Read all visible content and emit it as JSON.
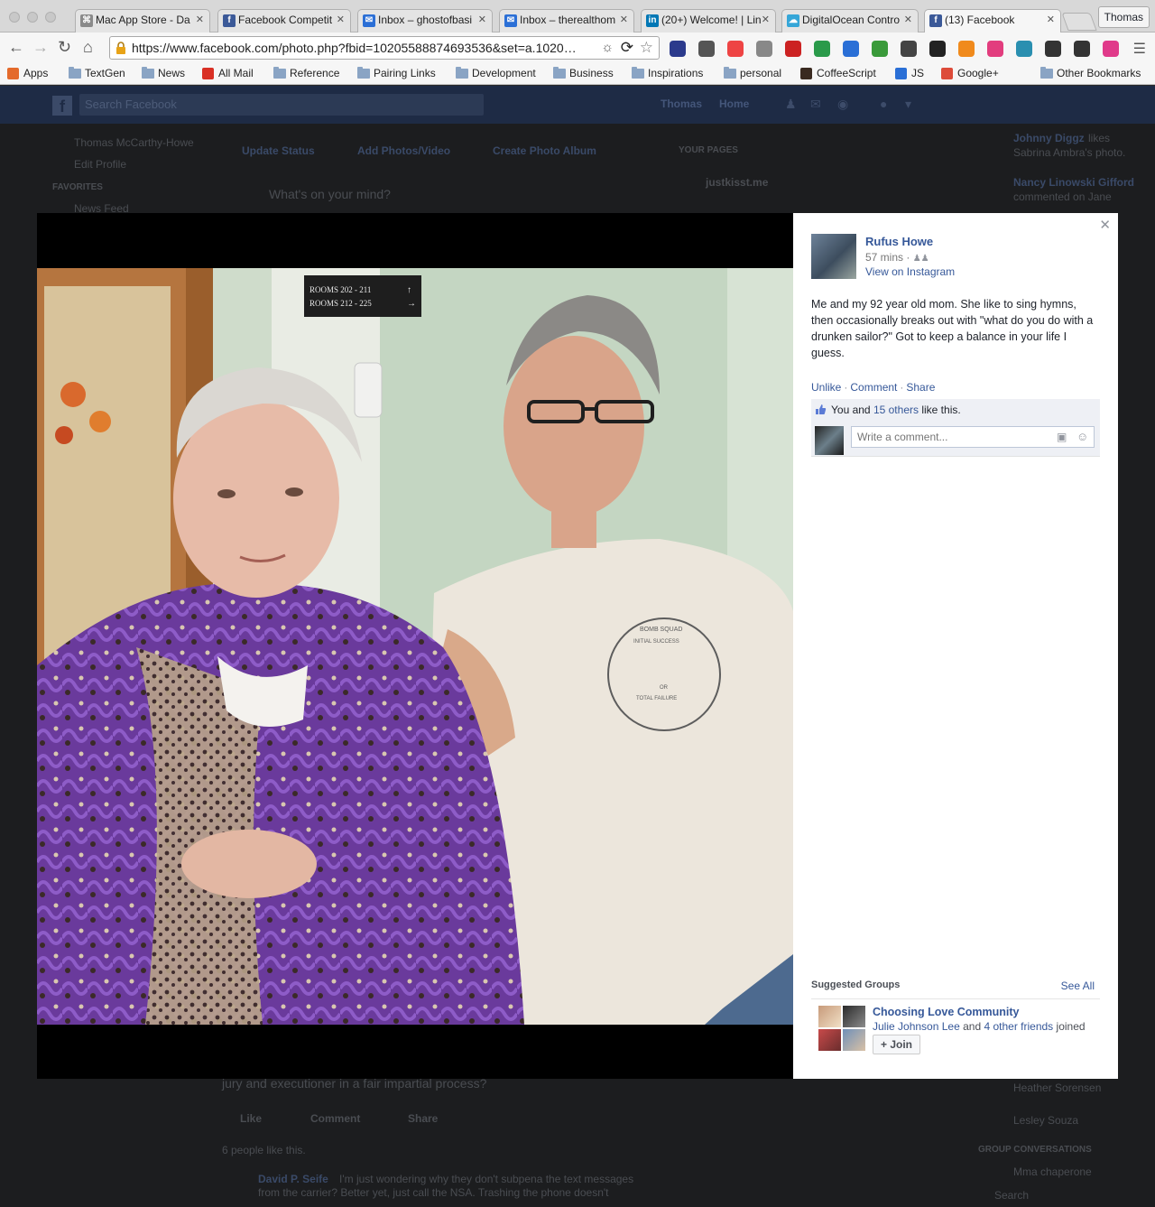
{
  "browser": {
    "tabs": [
      {
        "label": "Mac App Store - Da",
        "color": "#8a8a8a",
        "glyph": "⌘"
      },
      {
        "label": "Facebook Competit",
        "color": "#3b5998",
        "glyph": "f"
      },
      {
        "label": "Inbox – ghostofbasi",
        "color": "#2b6fd6",
        "glyph": "✉"
      },
      {
        "label": "Inbox – therealthom",
        "color": "#2b6fd6",
        "glyph": "✉"
      },
      {
        "label": "(20+) Welcome! | Lin",
        "color": "#0077b5",
        "glyph": "in"
      },
      {
        "label": "DigitalOcean Contro",
        "color": "#35a6d8",
        "glyph": "☁"
      },
      {
        "label": "(13) Facebook",
        "color": "#3b5998",
        "glyph": "f"
      }
    ],
    "profile_name": "Thomas",
    "url": "https://www.facebook.com/photo.php?fbid=10205588874693536&set=a.1020…",
    "bookmarks": [
      {
        "label": "Apps",
        "icon": "apps-grid-icon"
      },
      {
        "label": "TextGen",
        "icon": "folder-icon"
      },
      {
        "label": "News",
        "icon": "folder-icon"
      },
      {
        "label": "All Mail",
        "icon": "gmail-icon"
      },
      {
        "label": "Reference",
        "icon": "folder-icon"
      },
      {
        "label": "Pairing Links",
        "icon": "folder-icon"
      },
      {
        "label": "Development",
        "icon": "folder-icon"
      },
      {
        "label": "Business",
        "icon": "folder-icon"
      },
      {
        "label": "Inspirations",
        "icon": "folder-icon"
      },
      {
        "label": "personal",
        "icon": "folder-icon"
      },
      {
        "label": "CoffeeScript",
        "icon": "coffee-icon"
      },
      {
        "label": "JS",
        "icon": "js-icon"
      },
      {
        "label": "Google+",
        "icon": "googleplus-icon"
      },
      {
        "label": "Other Bookmarks",
        "icon": "folder-icon"
      }
    ]
  },
  "background_page": {
    "search_placeholder": "Search Facebook",
    "nav_user": "Thomas",
    "nav_home": "Home",
    "sidebar_user": "Thomas McCarthy-Howe",
    "edit_profile": "Edit Profile",
    "favorites": "FAVORITES",
    "news_feed": "News Feed",
    "update_status": "Update Status",
    "add_photos": "Add Photos/Video",
    "create_album": "Create Photo Album",
    "whats_on_mind": "What's on your mind?",
    "your_pages": "YOUR PAGES",
    "page_name": "justkisst.me",
    "post_text": "jury and executioner in a fair impartial process?",
    "like": "Like",
    "comment": "Comment",
    "share": "Share",
    "people_like": "6 people like this.",
    "comment_author": "David P. Seife",
    "comment_text": "I'm just wondering why they don't subpena the text messages",
    "comment_text2": "from the carrier? Better yet, just call the NSA. Trashing the phone doesn't",
    "ticker": [
      {
        "name": "Johnny Diggz",
        "text": "likes"
      },
      {
        "name": "",
        "text": "Sabrina Ambra's photo."
      },
      {
        "name": "Nancy Linowski Gifford",
        "text": ""
      },
      {
        "name": "",
        "text": "commented on Jane"
      }
    ],
    "chat": [
      "Heather Sorensen",
      "Lesley Souza"
    ],
    "group_conversations": "GROUP CONVERSATIONS",
    "group_chat": "Mma chaperone",
    "chat_search": "Search"
  },
  "post": {
    "author": "Rufus Howe",
    "time": "57 mins",
    "via": "View on Instagram",
    "caption": "Me and my 92 year old mom. She like to sing hymns, then occasionally breaks out with \"what do you do with a drunken sailor?\" Got to keep a balance in your life I guess.",
    "actions": {
      "unlike": "Unlike",
      "comment": "Comment",
      "share": "Share"
    },
    "likes": {
      "you": "You and",
      "others": "15 others",
      "suffix": "like this."
    },
    "comment_placeholder": "Write a comment...",
    "photo_sign": {
      "line1": "ROOMS 202 - 211",
      "line2": "ROOMS 212 - 225"
    },
    "shirt_text": {
      "top": "BOMB SQUAD",
      "mid": "INITIAL SUCCESS",
      "or": "OR",
      "bottom": "TOTAL FAILURE"
    }
  },
  "suggested_groups": {
    "title": "Suggested Groups",
    "see_all": "See All",
    "group_name": "Choosing Love Community",
    "member": "Julie Johnson Lee",
    "and": "and",
    "others": "4 other friends",
    "joined": "joined",
    "join_label": "+ Join"
  }
}
